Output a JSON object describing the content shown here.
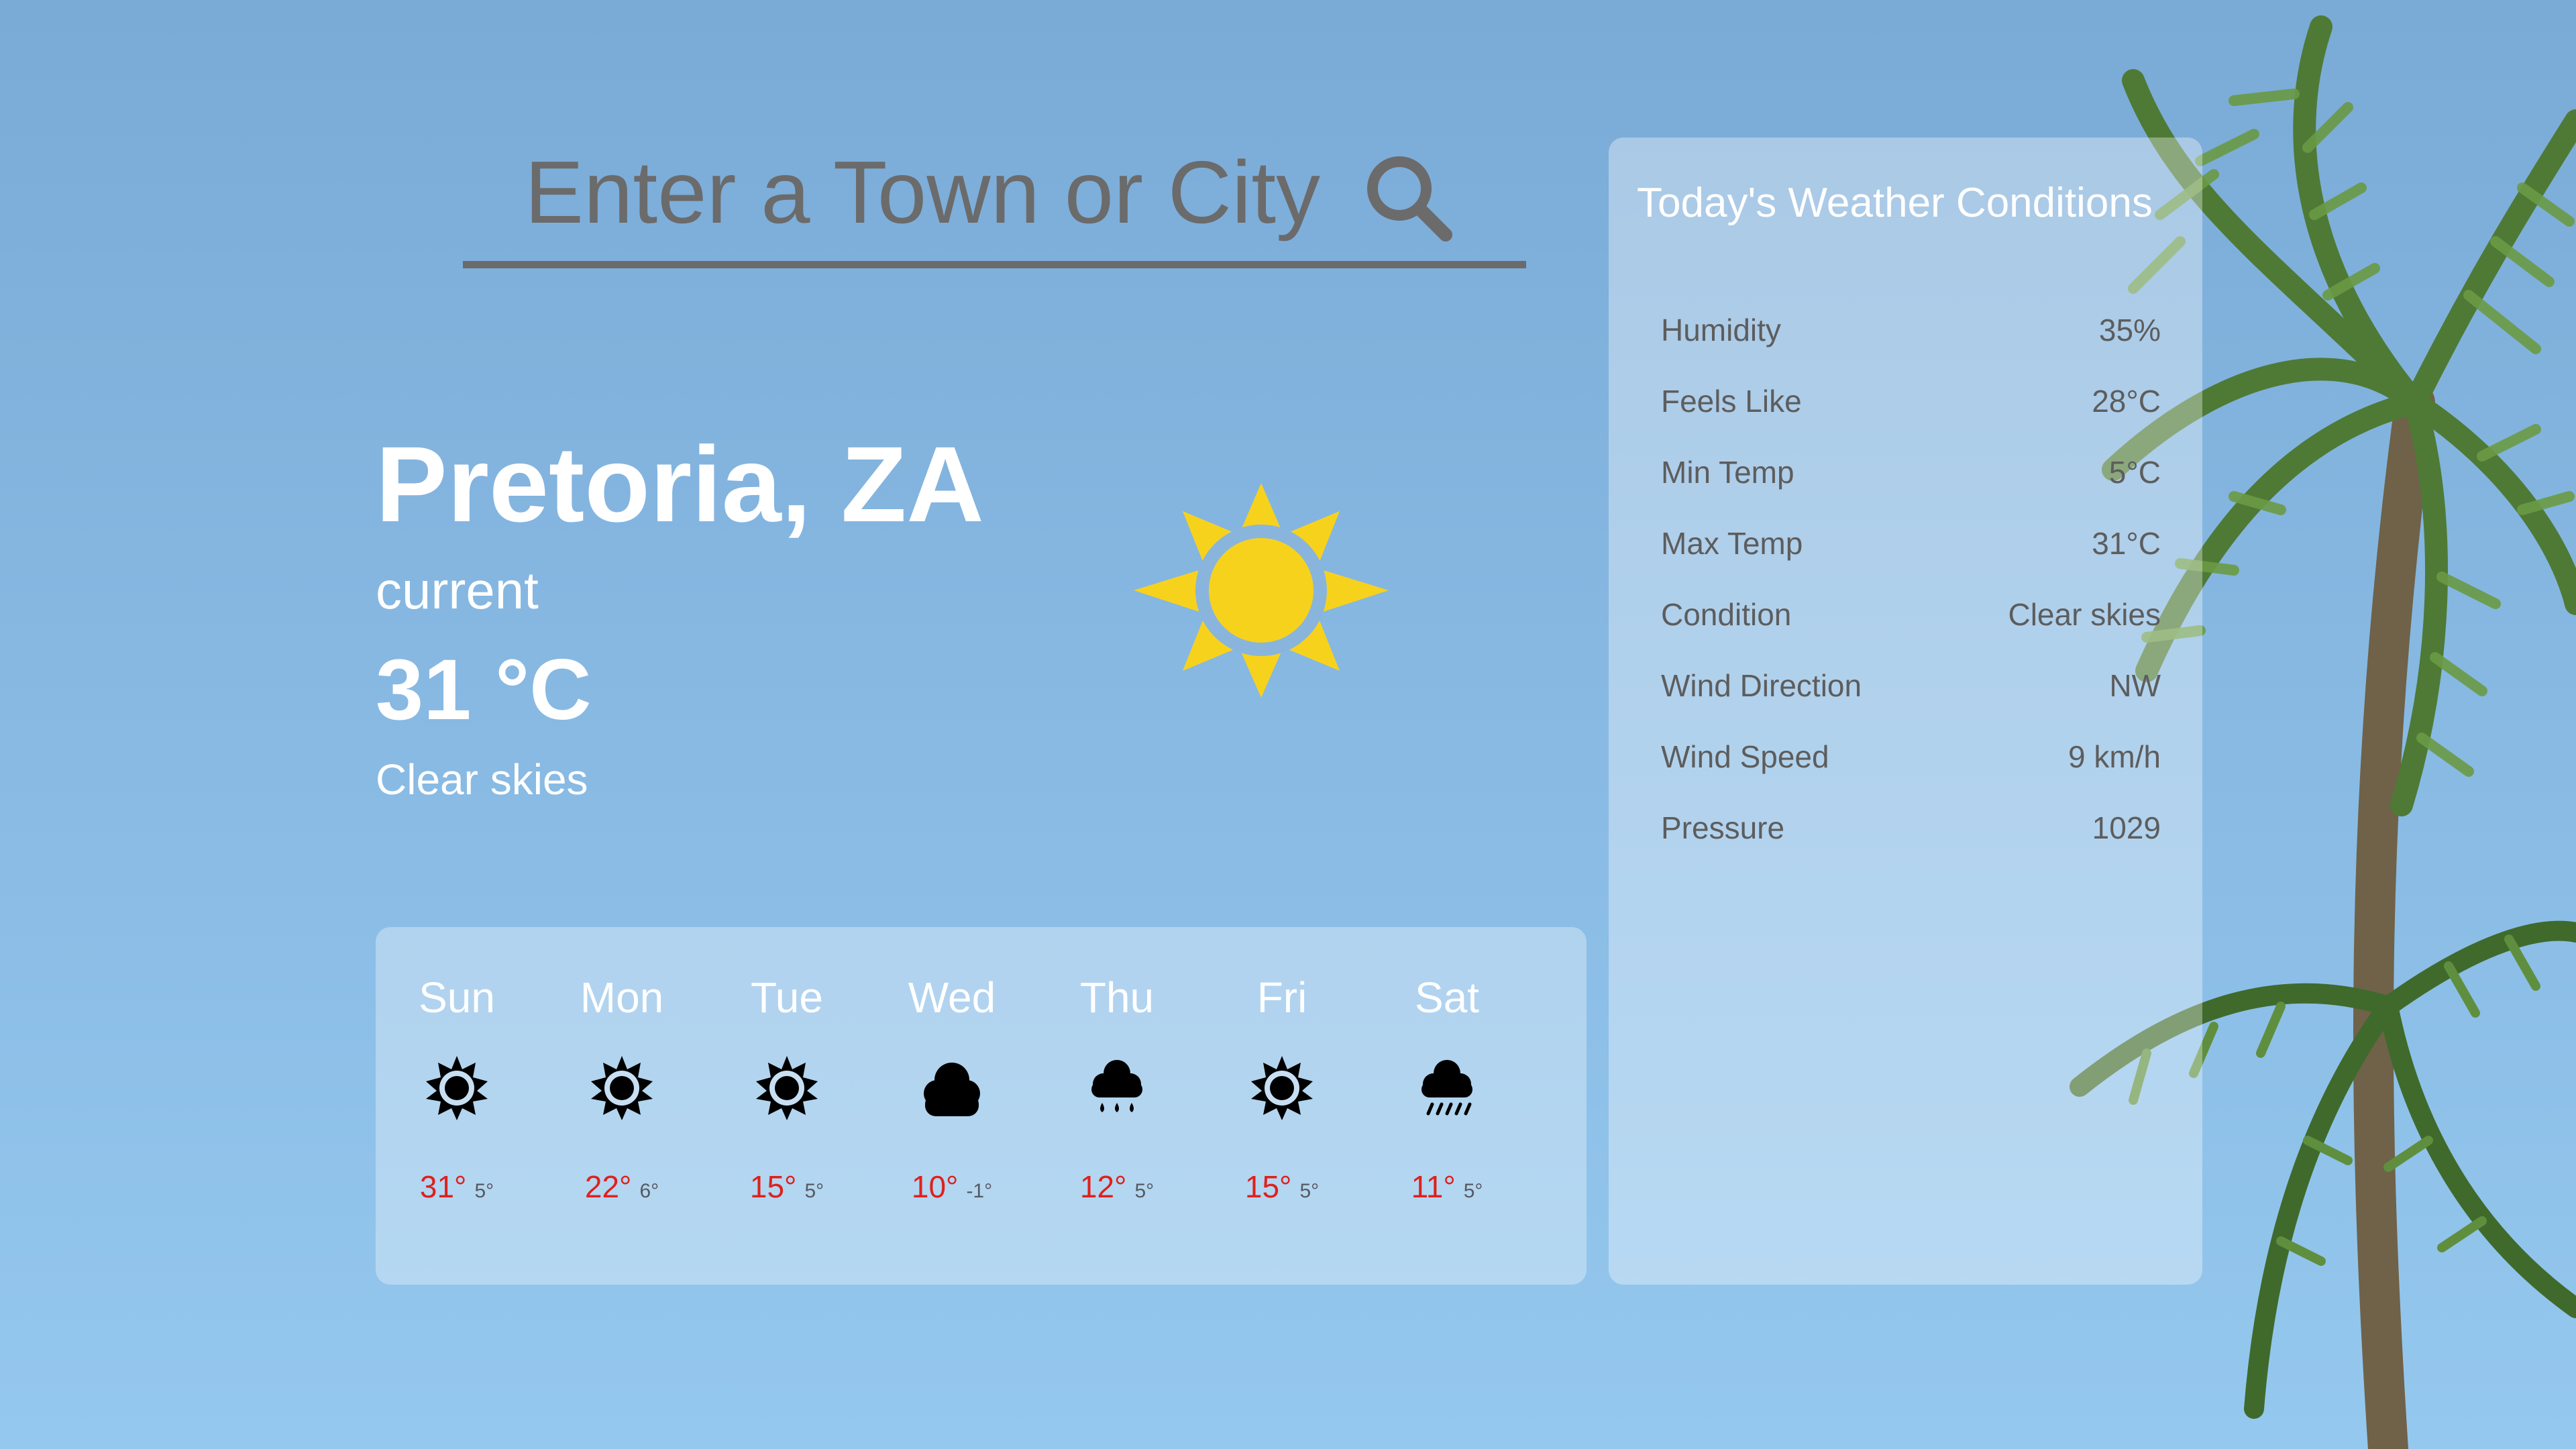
{
  "search": {
    "placeholder": "Enter a Town or City",
    "icon": "search-icon"
  },
  "current": {
    "city": "Pretoria, ZA",
    "label": "current",
    "temperature": "31 °C",
    "condition": "Clear skies",
    "icon": "sun-icon",
    "icon_color": "#f7d21d"
  },
  "forecast": {
    "days": [
      {
        "name": "Sun",
        "icon": "sun-icon",
        "high": "31°",
        "low": "5°"
      },
      {
        "name": "Mon",
        "icon": "sun-icon",
        "high": "22°",
        "low": "6°"
      },
      {
        "name": "Tue",
        "icon": "sun-icon",
        "high": "15°",
        "low": "5°"
      },
      {
        "name": "Wed",
        "icon": "cloud-icon",
        "high": "10°",
        "low": "-1°"
      },
      {
        "name": "Thu",
        "icon": "rain-icon",
        "high": "12°",
        "low": "5°"
      },
      {
        "name": "Fri",
        "icon": "sun-icon",
        "high": "15°",
        "low": "5°"
      },
      {
        "name": "Sat",
        "icon": "heavy-rain-icon",
        "high": "11°",
        "low": "5°"
      }
    ],
    "high_color": "#e0201c"
  },
  "conditions": {
    "title": "Today's Weather Conditions",
    "rows": [
      {
        "label": "Humidity",
        "value": "35%"
      },
      {
        "label": "Feels Like",
        "value": "28°C"
      },
      {
        "label": "Min Temp",
        "value": "5°C"
      },
      {
        "label": "Max Temp",
        "value": "31°C"
      },
      {
        "label": "Condition",
        "value": "Clear skies"
      },
      {
        "label": "Wind Direction",
        "value": "NW"
      },
      {
        "label": "Wind Speed",
        "value": "9 km/h"
      },
      {
        "label": "Pressure",
        "value": "1029"
      }
    ]
  }
}
